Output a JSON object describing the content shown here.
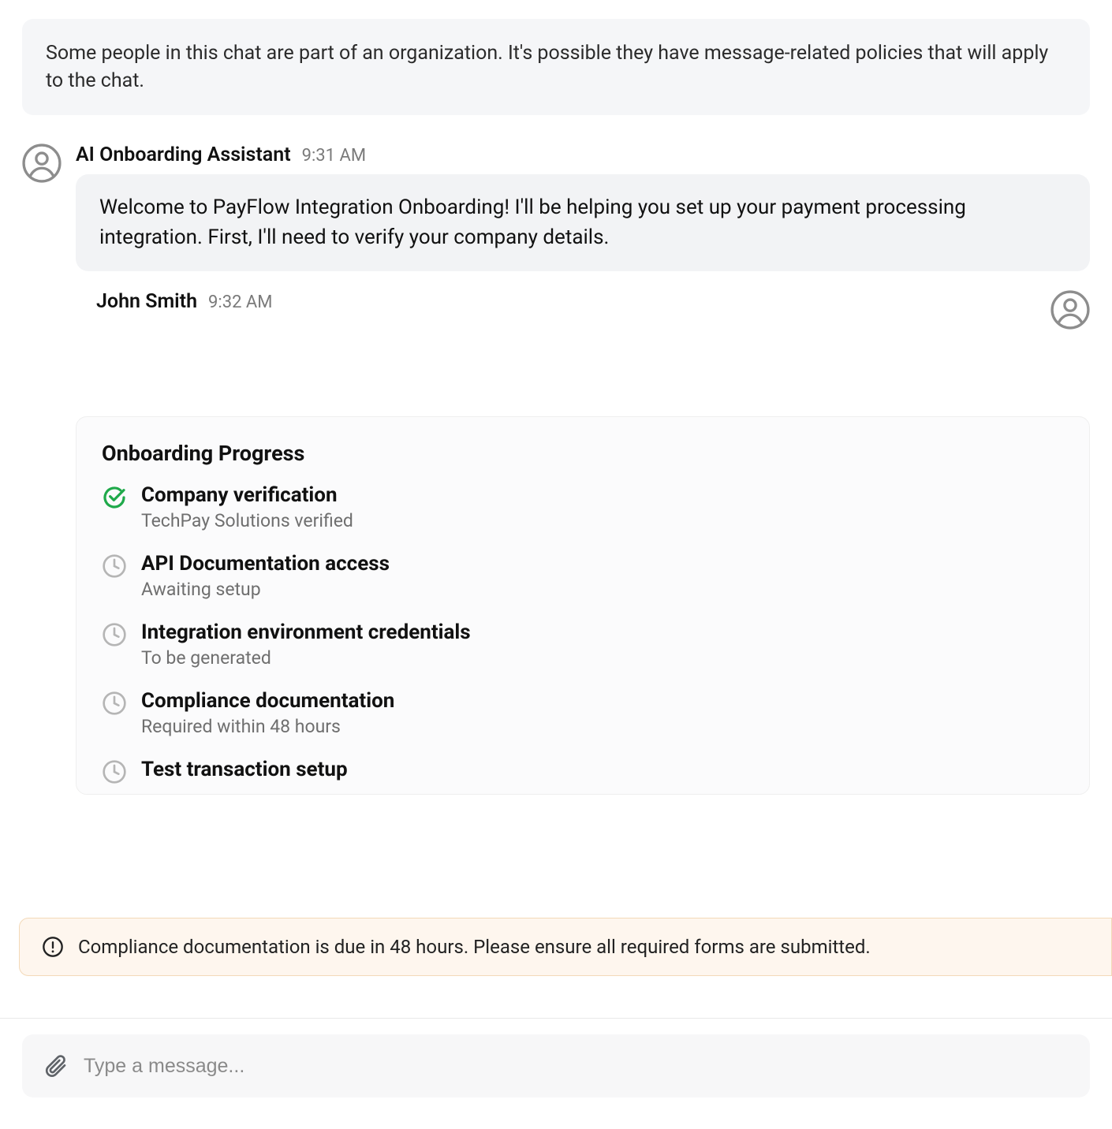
{
  "org_notice": "Some people in this chat are part of an organization. It's possible they have message-related policies that will apply to the chat.",
  "messages": {
    "m0": {
      "sender": "AI Onboarding Assistant",
      "time": "9:31 AM",
      "body": "Welcome to PayFlow Integration Onboarding! I'll be helping you set up your payment processing integration. First, I'll need to verify your company details."
    },
    "m1": {
      "sender": "John Smith",
      "time": "9:32 AM"
    }
  },
  "progress": {
    "title": "Onboarding Progress",
    "items": [
      {
        "title": "Company verification",
        "sub": "TechPay Solutions verified",
        "status": "done"
      },
      {
        "title": "API Documentation access",
        "sub": "Awaiting setup",
        "status": "pending"
      },
      {
        "title": "Integration environment credentials",
        "sub": "To be generated",
        "status": "pending"
      },
      {
        "title": "Compliance documentation",
        "sub": "Required within 48 hours",
        "status": "pending"
      },
      {
        "title": "Test transaction setup",
        "sub": "",
        "status": "pending"
      }
    ]
  },
  "alert": "Compliance documentation is due in 48 hours. Please ensure all required forms are submitted.",
  "composer": {
    "placeholder": "Type a message..."
  }
}
